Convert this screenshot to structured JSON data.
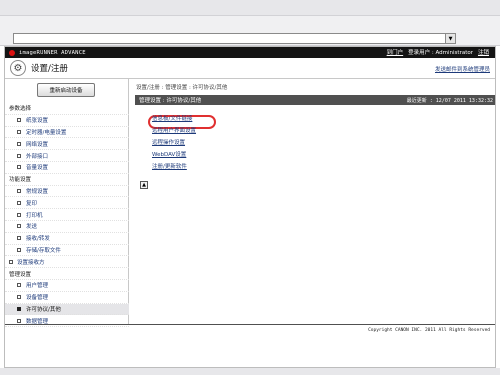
{
  "browser": {
    "address_value": "",
    "dropdown_glyph": "▼"
  },
  "header": {
    "product": "imageRUNNER ADVANCE",
    "portal_link": "到门户",
    "user_label": "登录用户 : Administrator",
    "logout_link": "注销"
  },
  "title": {
    "icon": "gear-icon",
    "text": "设置/注册",
    "mail_link": "发送邮件到系统管理员"
  },
  "sidebar": {
    "restart_label": "重新启动设备",
    "nav": [
      {
        "type": "section",
        "label": "参数选择"
      },
      {
        "type": "item",
        "label": "纸张设置"
      },
      {
        "type": "item",
        "label": "定时器/电量设置"
      },
      {
        "type": "item",
        "label": "网络设置"
      },
      {
        "type": "item",
        "label": "外部接口"
      },
      {
        "type": "item",
        "label": "音量设置"
      },
      {
        "type": "section",
        "label": "功能设置"
      },
      {
        "type": "item",
        "label": "常规设置"
      },
      {
        "type": "item",
        "label": "复印"
      },
      {
        "type": "item",
        "label": "打印机"
      },
      {
        "type": "item",
        "label": "发送"
      },
      {
        "type": "item",
        "label": "接收/转发"
      },
      {
        "type": "item",
        "label": "存储/存取文件"
      },
      {
        "type": "section-link",
        "label": "设置接收方"
      },
      {
        "type": "section",
        "label": "管理设置"
      },
      {
        "type": "item",
        "label": "用户管理"
      },
      {
        "type": "item",
        "label": "设备管理"
      },
      {
        "type": "item",
        "label": "许可协议/其他",
        "active": true
      },
      {
        "type": "item",
        "label": "数据管理"
      }
    ]
  },
  "main": {
    "breadcrumb": "设置/注册 : 管理设置 : 许可协议/其他",
    "section_title": "管理设置 : 许可协议/其他",
    "last_updated": "最近更新 : 12/07 2011 13:32:32",
    "links": [
      "信息板/文件链接",
      "远程用户界面设置",
      "远程操作设置",
      "WebDAV设置",
      "注册/更新软件"
    ],
    "top_glyph": "▲"
  },
  "footer": {
    "copyright": "Copyright CANON INC. 2011 All Rights Reserved"
  },
  "colors": {
    "header_bg": "#141414",
    "section_bg": "#505050",
    "link": "#1d3a7a",
    "highlight": "#e03030",
    "canon_red": "#d11111"
  }
}
